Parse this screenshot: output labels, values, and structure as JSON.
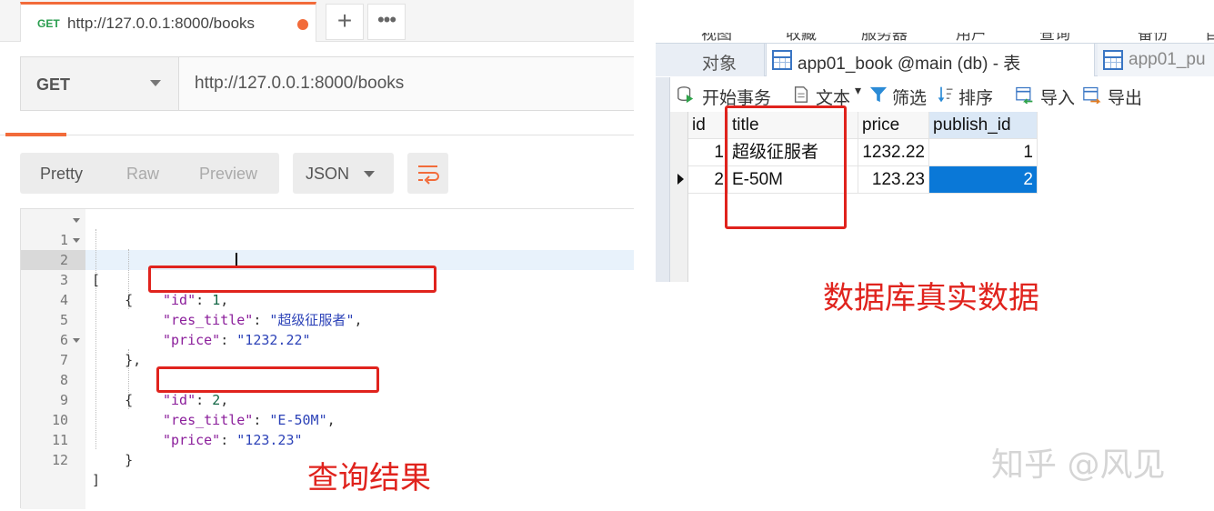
{
  "postman": {
    "tab": {
      "method": "GET",
      "url": "http://127.0.0.1:8000/books"
    },
    "new_tab_label": "+",
    "more_label": "•••",
    "request": {
      "method": "GET",
      "url": "http://127.0.0.1:8000/books"
    },
    "view_tabs": [
      "Pretty",
      "Raw",
      "Preview"
    ],
    "format": "JSON",
    "code_lines": [
      {
        "no": "1",
        "text": "["
      },
      {
        "no": "2",
        "text": "    {"
      },
      {
        "no": "3",
        "key": "\"id\"",
        "value": "1"
      },
      {
        "no": "4",
        "key": "\"res_title\"",
        "value": "\"超级征服者\""
      },
      {
        "no": "5",
        "key": "\"price\"",
        "value": "\"1232.22\""
      },
      {
        "no": "6",
        "text": "    },"
      },
      {
        "no": "7",
        "text": "    {"
      },
      {
        "no": "8",
        "key": "\"id\"",
        "value": "2"
      },
      {
        "no": "9",
        "key": "\"res_title\"",
        "value": "\"E-50M\""
      },
      {
        "no": "10",
        "key": "\"price\"",
        "value": "\"123.23\""
      },
      {
        "no": "11",
        "text": "    }"
      },
      {
        "no": "12",
        "text": "]"
      }
    ]
  },
  "captions": {
    "left": "查询结果",
    "right": "数据库真实数据",
    "watermark": "知乎 @风见"
  },
  "navicat": {
    "menu": [
      "视图",
      "收藏",
      "服务器",
      "用户",
      "查询",
      "备份",
      "自"
    ],
    "tabs": {
      "objects": "对象",
      "active": "app01_book @main (db) - 表",
      "next": "app01_pu"
    },
    "toolbar": {
      "begin_tx": "开始事务",
      "text": "文本",
      "filter": "筛选",
      "sort": "排序",
      "import": "导入",
      "export": "导出"
    },
    "columns": [
      "id",
      "title",
      "price",
      "publish_id"
    ],
    "rows": [
      {
        "id": "1",
        "title": "超级征服者",
        "price": "1232.22",
        "publish_id": "1"
      },
      {
        "id": "2",
        "title": "E-50M",
        "price": "123.23",
        "publish_id": "2"
      }
    ],
    "colors": {
      "selection": "#0a78d7",
      "highlight": "#e0231d"
    }
  }
}
